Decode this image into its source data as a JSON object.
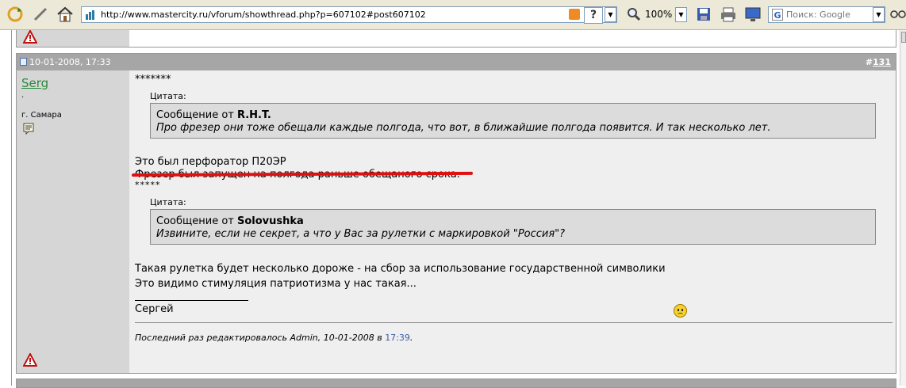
{
  "browser": {
    "url": "http://www.mastercity.ru/vforum/showthread.php?p=607102#post607102",
    "zoom": "100%",
    "search_placeholder": "Поиск: Google",
    "help_label": "?",
    "search_engine_letter": "G"
  },
  "post": {
    "date": "10-01-2008, 17:33",
    "number_prefix": "#",
    "number": "131",
    "author": {
      "name": "Serg",
      "title": "·",
      "location": "г. Самара"
    },
    "lines": {
      "stars1": "*******",
      "stars2": "*****",
      "plain1": "Это был перфоратор П20ЭР",
      "plain2": "Фрезер был запущен на полгода раньше обещаного срока.",
      "plain3": "Такая рулетка будет несколько дороже - на сбор за использование государственной символики",
      "plain4": "Это видимо стимуляция патриотизма у нас такая...",
      "signature": "Сергей"
    },
    "quotes": [
      {
        "label": "Цитата:",
        "from_prefix": "Сообщение от ",
        "author": "R.H.T.",
        "text": "Про фрезер они тоже обещали каждые полгода, что вот, в ближайшие полгода появится. И так несколько лет."
      },
      {
        "label": "Цитата:",
        "from_prefix": "Сообщение от ",
        "author": "Solovushka",
        "text": "Извините, если не секрет, а что у Вас за рулетки с маркировкой \"Россия\"?"
      }
    ],
    "edited": {
      "prefix": "Последний раз редактировалось Admin, 10-01-2008 в ",
      "time": "17:39",
      "suffix": "."
    }
  },
  "colors": {
    "post_header": "#a6a6a6",
    "author_column": "#d6d6d6",
    "content_bg": "#efefef",
    "quote_bg": "#dcdcdc",
    "username": "#2a8a3a",
    "red_underline": "#e01010"
  }
}
